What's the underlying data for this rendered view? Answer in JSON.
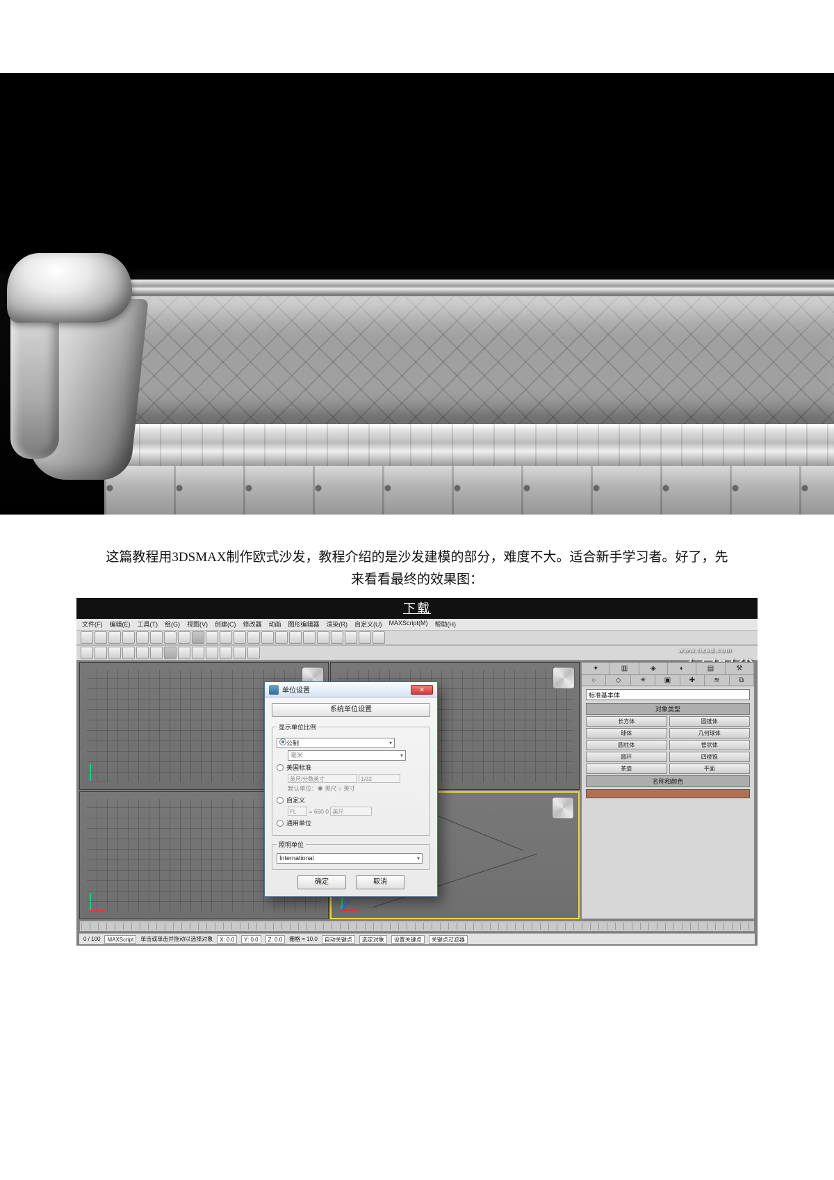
{
  "intro": {
    "line1": "这篇教程用3DSMAX制作欧式沙发，教程介绍的是沙发建模的部分，难度不大。适合新手学习者。好了，先",
    "line2": "来看看最终的效果图："
  },
  "download_bar": "下载",
  "watermark": {
    "brand": "火星时代",
    "url": "www.hxsd.com"
  },
  "max": {
    "menus": [
      "文件(F)",
      "编辑(E)",
      "工具(T)",
      "组(G)",
      "视图(V)",
      "创建(C)",
      "修改器",
      "动画",
      "图形编辑器",
      "渲染(R)",
      "自定义(U)",
      "MAXScript(M)",
      "帮助(H)"
    ],
    "panel_dropdown": "标准基本体",
    "rollout_type_header": "对象类型",
    "prim_buttons": [
      [
        "长方体",
        "圆锥体"
      ],
      [
        "球体",
        "几何球体"
      ],
      [
        "圆柱体",
        "管状体"
      ],
      [
        "圆环",
        "四棱锥"
      ],
      [
        "茶壶",
        "平面"
      ]
    ],
    "rollout_color_header": "名称和颜色",
    "timeline_label": "0 / 100",
    "status_left": "MAXScript",
    "status_hint": "单击或单击并拖动以选择对象",
    "coord_x": "X: 0.0",
    "coord_y": "Y: 0.0",
    "coord_z": "Z: 0.0",
    "grid_label": "栅格 = 10.0",
    "key_btn1": "自动关键点",
    "key_btn2": "设置关键点",
    "key_btn3": "关键点过滤器",
    "autokey": "选定对象"
  },
  "dialog": {
    "title": "单位设置",
    "close_glyph": "✕",
    "system_btn": "系统单位设置",
    "group_scale": "显示单位比例",
    "radio_metric": "公制",
    "metric_value": "毫米",
    "radio_us": "美国标准",
    "us_line1": "英尺/分数英寸",
    "us_line1_val": "1/32",
    "us_line2": "默认单位：◉ 英尺  ○ 英寸",
    "radio_custom": "自定义",
    "custom_fl": "FL",
    "custom_eq": "= 660.0",
    "custom_unit": "英尺",
    "radio_generic": "通用单位",
    "group_light": "照明单位",
    "light_value": "International",
    "ok": "确定",
    "cancel": "取消"
  }
}
